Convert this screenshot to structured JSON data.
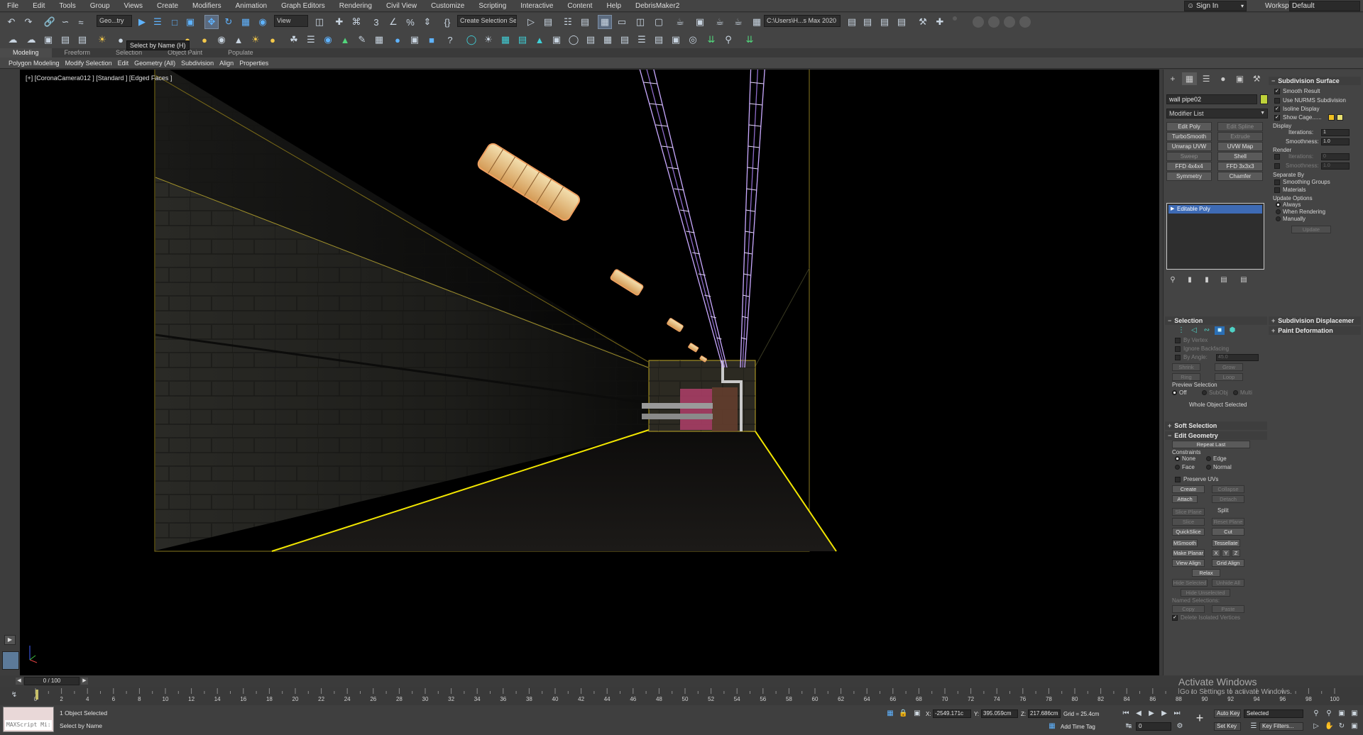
{
  "menu": [
    "File",
    "Edit",
    "Tools",
    "Group",
    "Views",
    "Create",
    "Modifiers",
    "Animation",
    "Graph Editors",
    "Rendering",
    "Civil View",
    "Customize",
    "Scripting",
    "Interactive",
    "Content",
    "Help",
    "DebrisMaker2"
  ],
  "account": {
    "sign_in": "Sign In",
    "workspaces_label": "Workspaces:",
    "workspace": "Default"
  },
  "toolbar": {
    "selection_filter": "Geo...try",
    "ref_coord": "View",
    "named_selection": "Create Selection Se",
    "project_path": "C:\\Users\\H...s Max 2020",
    "tooltip": "Select by Name  (H)"
  },
  "ribbon": {
    "tabs": [
      "Modeling",
      "Freeform",
      "Selection",
      "Object Paint",
      "Populate"
    ],
    "items": [
      "Polygon Modeling",
      "Modify Selection",
      "Edit",
      "Geometry (All)",
      "Subdivision",
      "Align",
      "Properties"
    ]
  },
  "viewport": {
    "label": "[+] [CoronaCamera012 ] [Standard ] [Edged Faces ]"
  },
  "command_panel": {
    "object_name": "wall pipe02",
    "modifier_list": "Modifier List",
    "modifier_buttons": [
      "Edit Poly",
      "Edit Spline",
      "TurboSmooth",
      "Extrude",
      "Unwrap UVW",
      "UVW Map",
      "Sweep",
      "Shell",
      "FFD 4x4x4",
      "FFD 3x3x3",
      "Symmetry",
      "Chamfer"
    ],
    "stack_item": "Editable Poly",
    "selection": {
      "title": "Selection",
      "by_vertex": "By Vertex",
      "ignore_backfacing": "Ignore Backfacing",
      "by_angle": "By Angle:",
      "by_angle_value": "45.0",
      "shrink": "Shrink",
      "grow": "Grow",
      "ring": "Ring",
      "loop": "Loop",
      "preview_label": "Preview Selection",
      "preview_off": "Off",
      "preview_subobj": "SubObj",
      "preview_multi": "Multi",
      "status": "Whole Object Selected"
    },
    "soft_selection": "Soft Selection",
    "edit_geometry": {
      "title": "Edit Geometry",
      "repeat_last": "Repeat Last",
      "constraints": "Constraints",
      "none": "None",
      "edge": "Edge",
      "face": "Face",
      "normal": "Normal",
      "preserve_uvs": "Preserve UVs",
      "create": "Create",
      "collapse": "Collapse",
      "attach": "Attach",
      "detach": "Detach",
      "slice_plane": "Slice Plane",
      "split": "Split",
      "slice": "Slice",
      "reset_plane": "Reset Plane",
      "quickslice": "QuickSlice",
      "cut": "Cut",
      "msmooth": "MSmooth",
      "tessellate": "Tessellate",
      "make_planar": "Make Planar",
      "x": "X",
      "y": "Y",
      "z": "Z",
      "view_align": "View Align",
      "grid_align": "Grid Align",
      "relax": "Relax",
      "hide_selected": "Hide Selected",
      "unhide_all": "Unhide All",
      "hide_unselected": "Hide Unselected",
      "named_selections": "Named Selections:",
      "copy": "Copy",
      "paste": "Paste",
      "delete_isolated": "Delete Isolated Vertices"
    },
    "subdivision_surface": {
      "title": "Subdivision Surface",
      "smooth_result": "Smooth Result",
      "use_nurms": "Use NURMS Subdivision",
      "isoline_display": "Isoline Display",
      "show_cage": "Show Cage......",
      "display": "Display",
      "iterations_label": "Iterations:",
      "display_iterations": "1",
      "smoothness_label": "Smoothness:",
      "display_smoothness": "1.0",
      "render": "Render",
      "render_iterations": "0",
      "render_smoothness": "1.0",
      "separate_by": "Separate By",
      "smoothing_groups": "Smoothing Groups",
      "materials": "Materials",
      "update_options": "Update Options",
      "always": "Always",
      "when_rendering": "When Rendering",
      "manually": "Manually",
      "update": "Update"
    },
    "subdivision_displacement": "Subdivision Displacemer",
    "paint_deformation": "Paint Deformation"
  },
  "timeline": {
    "frame": "0 / 100",
    "ticks": [
      "0",
      "2",
      "4",
      "6",
      "8",
      "10",
      "12",
      "14",
      "16",
      "18",
      "20",
      "22",
      "24",
      "26",
      "28",
      "30",
      "32",
      "34",
      "36",
      "38",
      "40",
      "42",
      "44",
      "46",
      "48",
      "50",
      "52",
      "54",
      "56",
      "58",
      "60",
      "62",
      "64",
      "66",
      "68",
      "70",
      "72",
      "74",
      "76",
      "78",
      "80",
      "82",
      "84",
      "86",
      "88",
      "90",
      "92",
      "94",
      "96",
      "98",
      "100"
    ]
  },
  "status": {
    "maxscript": "MAXScript Mi:",
    "selected": "1 Object Selected",
    "prompt": "Select by Name",
    "x_label": "X:",
    "x_value": "-2549.171c",
    "y_label": "Y:",
    "y_value": "395.059cm",
    "z_label": "Z:",
    "z_value": "217.686cm",
    "grid": "Grid = 25.4cm",
    "add_time_tag": "Add Time Tag",
    "auto_key": "Auto Key",
    "selected_set": "Selected",
    "set_key": "Set Key",
    "key_filters": "Key Filters...",
    "current_frame": "0"
  },
  "watermark": {
    "title": "Activate Windows",
    "subtitle": "Go to Settings to activate Windows."
  },
  "colors": {
    "selection_yellow": "#f2e600",
    "pipe_wire": "#c9a9ff",
    "light_wire": "#f0a060",
    "stack_blue": "#3e6bb5",
    "object_color": "#bfd23a"
  }
}
